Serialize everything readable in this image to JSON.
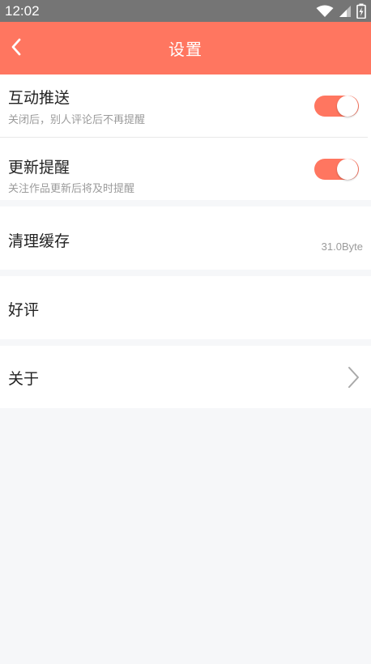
{
  "status_bar": {
    "time": "12:02"
  },
  "header": {
    "title": "设置"
  },
  "settings": {
    "push": {
      "title": "互动推送",
      "subtitle": "关闭后，别人评论后不再提醒",
      "enabled": true
    },
    "update": {
      "title": "更新提醒",
      "subtitle": "关注作品更新后将及时提醒",
      "enabled": true
    },
    "cache": {
      "title": "清理缓存",
      "size": "31.0Byte"
    },
    "rating": {
      "title": "好评"
    },
    "about": {
      "title": "关于"
    }
  },
  "colors": {
    "accent": "#ff7660",
    "status_bar": "#757575",
    "background": "#f6f7f9"
  },
  "icons": {
    "back": "chevron-left-icon",
    "wifi": "wifi-icon",
    "signal": "signal-icon",
    "battery": "battery-icon",
    "about_arrow": "chevron-right-icon"
  }
}
